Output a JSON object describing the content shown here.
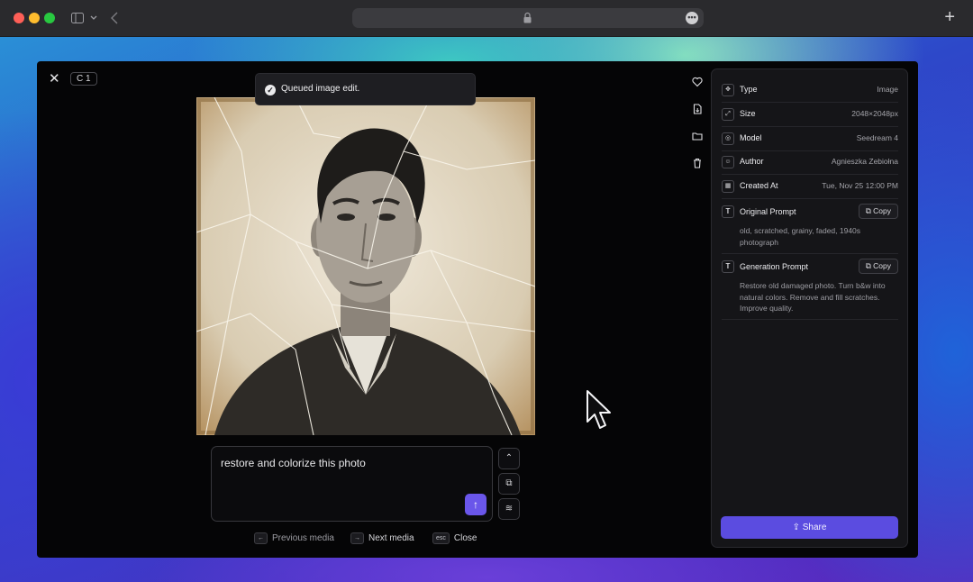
{
  "toolbar": {
    "url_more": "•••",
    "new_tab": "+"
  },
  "viewer": {
    "close": "✕",
    "counter": "C 1",
    "toast": "Queued image edit.",
    "prompt_value": "restore and colorize this photo",
    "send": "↑",
    "tools": [
      "⌃",
      "⧉",
      "≋"
    ],
    "hints": [
      {
        "key": "←",
        "label": "Previous media"
      },
      {
        "key": "→",
        "label": "Next media"
      },
      {
        "key": "esc",
        "label": "Close"
      }
    ]
  },
  "details": {
    "rows": [
      {
        "icon": "✥",
        "label": "Type",
        "value": "Image"
      },
      {
        "icon": "⤢",
        "label": "Size",
        "value": "2048×2048px"
      },
      {
        "icon": "◎",
        "label": "Model",
        "value": "Seedream 4"
      },
      {
        "icon": "☺",
        "label": "Author",
        "value": "Agnieszka Zebiołna"
      },
      {
        "icon": "▦",
        "label": "Created At",
        "value": "Tue, Nov 25 12:00 PM"
      }
    ],
    "original_prompt": {
      "icon": "T",
      "label": "Original Prompt",
      "copy": "⧉ Copy",
      "text": "old, scratched, grainy, faded, 1940s photograph"
    },
    "generation_prompt": {
      "icon": "T",
      "label": "Generation Prompt",
      "copy": "⧉ Copy",
      "text": "Restore old damaged photo. Turn b&w into natural colors. Remove and fill scratches. Improve quality."
    },
    "share": "⇪  Share"
  },
  "colors": {
    "accent": "#5b4ce0",
    "send": "#6a56ea",
    "panel": "#151518",
    "modal": "#050506"
  }
}
